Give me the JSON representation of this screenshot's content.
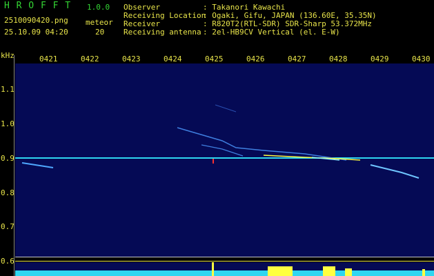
{
  "header": {
    "app_title": "H R O F F T",
    "version": "1.0.0",
    "filename": "2510090420.png",
    "datetime": "25.10.09 04:20",
    "meteor_label": "meteor",
    "meteor_count": "20",
    "info": [
      {
        "label": "Observer",
        "value": ": Takanori Kawachi"
      },
      {
        "label": "Receiving Location",
        "value": ": Ogaki, Gifu, JAPAN (136.60E, 35.35N)"
      },
      {
        "label": "Receiver",
        "value": ": R820T2(RTL-SDR) SDR-Sharp 53.372MHz"
      },
      {
        "label": "Receiving antenna",
        "value": ": 2el-HB9CV Vertical (el. E-W)"
      }
    ]
  },
  "time_axis": {
    "ticks": [
      "0421",
      "0422",
      "0423",
      "0424",
      "0425",
      "0426",
      "0427",
      "0428",
      "0429",
      "0430"
    ]
  },
  "freq_axis": {
    "unit": "kHz",
    "ticks": [
      "1.1",
      "1.0",
      "0.9",
      "0.8",
      "0.7",
      "0.6"
    ]
  },
  "colors": {
    "background": "#000000",
    "spectrogram": "#050a55",
    "trace": "#4fa8ff",
    "carrier": "#2fd6f0",
    "bright": "#ffff40",
    "text_green": "#34d634",
    "text_yellow": "#e8e44a"
  }
}
